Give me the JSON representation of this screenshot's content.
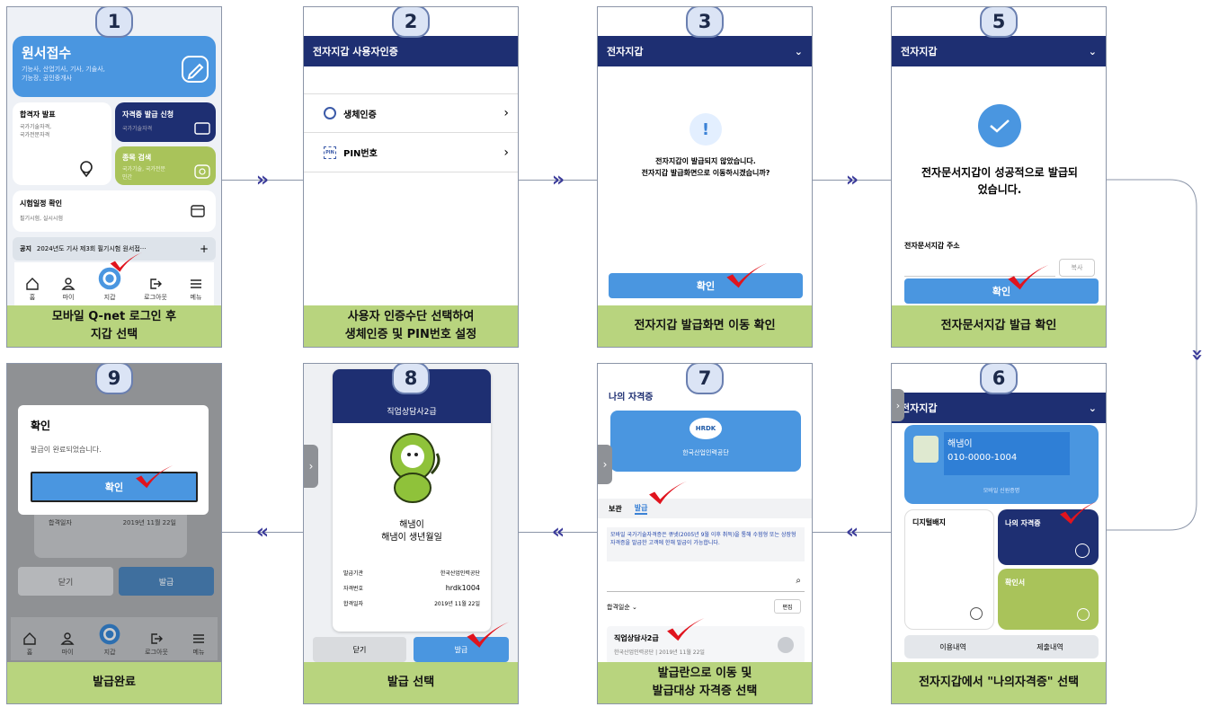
{
  "steps": {
    "s1": {
      "num": "1",
      "caption": "모바일 Q-net 로그인 후\n지갑 선택",
      "app_title": "원서접수",
      "app_sub": "기능사, 산업기사, 기사, 기술사,\n기능장, 공인중개사",
      "result_title": "합격자 발표",
      "result_sub": "국가기술자격,\n국가전문자격",
      "cert_title": "자격증 발급 신청",
      "cert_sub": "국가기술자격",
      "search_title": "종목 검색",
      "search_sub": "국가기술, 국가전문\n민간",
      "sched_title": "시험일정 확인",
      "sched_sub": "필기시험, 실시시험",
      "notice_label": "공지",
      "notice_text": "2024년도 기사 제3회 필기시험 원서접···",
      "nav": [
        "홈",
        "마이",
        "지갑",
        "로그아웃",
        "메뉴"
      ]
    },
    "s2": {
      "num": "2",
      "caption": "사용자 인증수단 선택하여\n생체인증 및 PIN번호 설정",
      "header": "전자지갑 사용자인증",
      "bio": "생체인증",
      "pin": "PIN번호"
    },
    "s3": {
      "num": "3",
      "caption": "전자지갑 발급화면 이동 확인",
      "header": "전자지갑",
      "msg": "전자지갑이 발급되지 않았습니다.\n전자지갑 발급화면으로 이동하시겠습니까?",
      "btn": "확인"
    },
    "s5": {
      "num": "5",
      "caption": "전자문서지갑 발급 확인",
      "header": "전자지갑",
      "msg": "전자문서지갑이 성공적으로 발급되\n었습니다.",
      "addr_label": "전자문서지갑 주소",
      "copy": "복사",
      "btn": "확인"
    },
    "s6": {
      "num": "6",
      "caption": "전자지갑에서 \"나의자격증\" 선택",
      "header": "전자지갑",
      "name": "해냄이",
      "phone": "010-0000-1004",
      "mobile_id": "모바일 신원증명",
      "digital": "디지털배지",
      "my_cert": "나의 자격증",
      "confirm": "확인서",
      "usage": "이용내역",
      "submit": "제출내역"
    },
    "s7": {
      "num": "7",
      "caption": "발급란으로 이동 및\n발급대상 자격증 선택",
      "header": "나의 자격증",
      "org": "한국산업인력공단",
      "logo": "HRDK",
      "tab_keep": "보관",
      "tab_issue": "발급",
      "notice": "모바일 국가기술자격증은 큐넷(2005년 9월 이후 취득)을 통해 수험형 또는 상장형 자격증을 발급한 고객에 한해 발급이 가능합니다.",
      "sort": "합격일순",
      "edit": "편집",
      "item_title": "직업상담사2급",
      "item_sub": "한국산업인력공단 | 2019년 11월 22일"
    },
    "s8": {
      "num": "8",
      "caption": "발급 선택",
      "cert_title": "직업상담사2급",
      "name": "해냄이",
      "birth": "해냄이 생년월일",
      "rows": [
        {
          "k": "발급기관",
          "v": "한국산업인력공단"
        },
        {
          "k": "자격번호",
          "v": "hrdk1004"
        },
        {
          "k": "합격일자",
          "v": "2019년 11월 22일"
        }
      ],
      "close": "닫기",
      "issue": "발급"
    },
    "s9": {
      "num": "9",
      "caption": "발급완료",
      "dialog_title": "확인",
      "dialog_msg": "발급이 완료되었습니다.",
      "btn": "확인",
      "bg_label": "합격일자",
      "bg_date": "2019년 11월 22일",
      "close": "닫기",
      "issue": "발급",
      "nav": [
        "홈",
        "마이",
        "지갑",
        "로그아웃",
        "메뉴"
      ]
    }
  },
  "colors": {
    "navy": "#1e2f72",
    "blue": "#4a96e0",
    "green": "#b8d47e",
    "check": "#e0141e"
  }
}
